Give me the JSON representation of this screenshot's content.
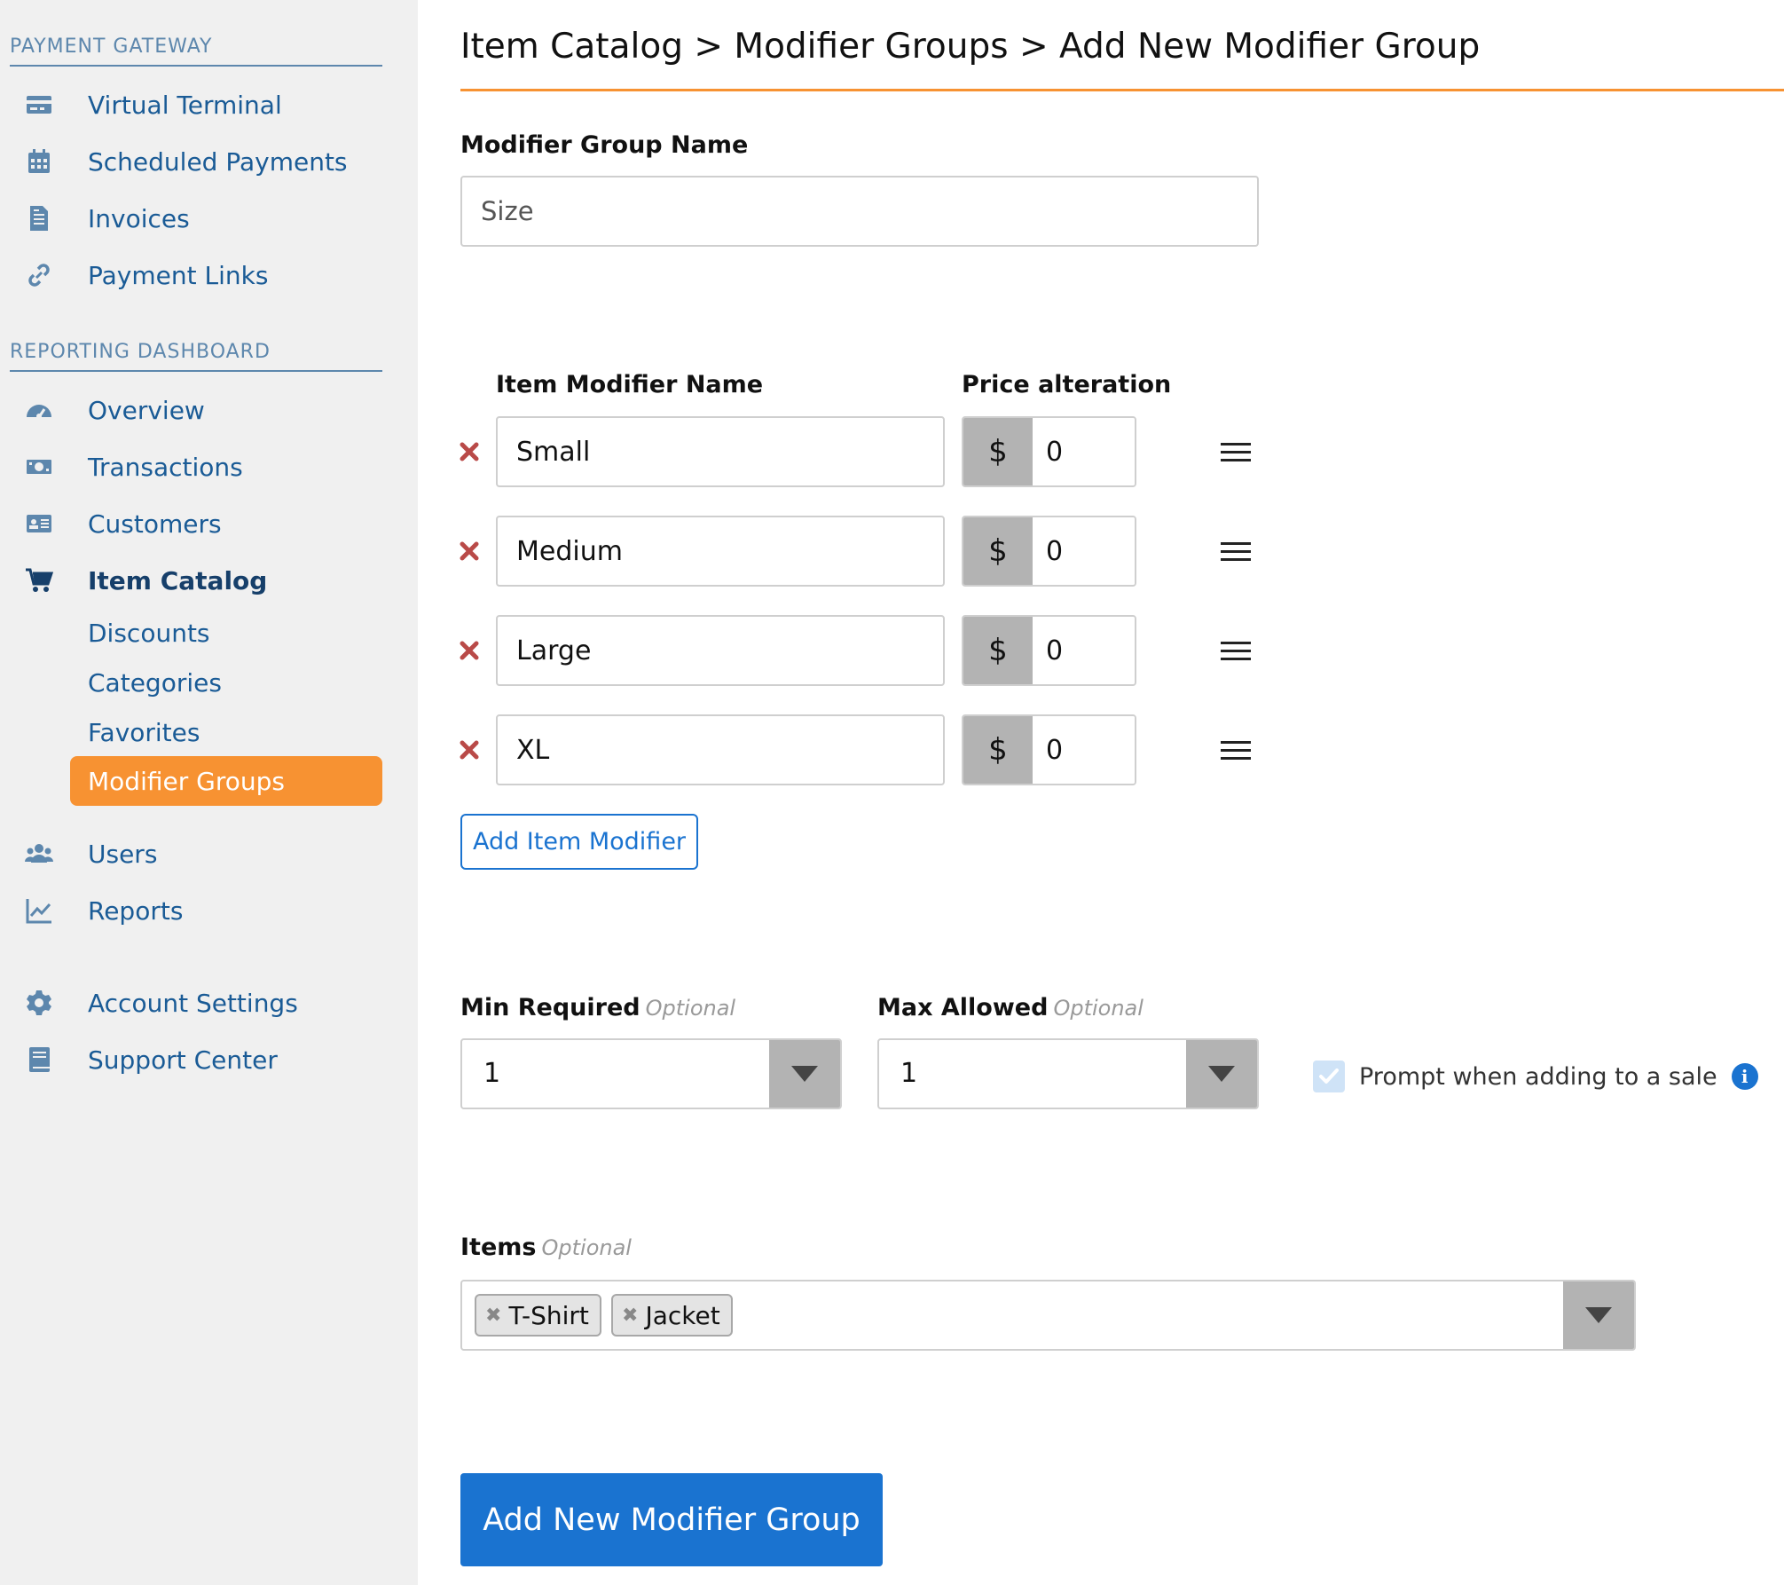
{
  "sidebar": {
    "payment_gateway_heading": "PAYMENT GATEWAY",
    "payment_items": [
      {
        "label": "Virtual Terminal",
        "icon": "credit-card-icon"
      },
      {
        "label": "Scheduled Payments",
        "icon": "calendar-icon"
      },
      {
        "label": "Invoices",
        "icon": "invoice-icon"
      },
      {
        "label": "Payment Links",
        "icon": "link-icon"
      }
    ],
    "reporting_heading": "REPORTING DASHBOARD",
    "reporting_items": [
      {
        "label": "Overview",
        "icon": "gauge-icon"
      },
      {
        "label": "Transactions",
        "icon": "money-icon"
      },
      {
        "label": "Customers",
        "icon": "id-card-icon"
      },
      {
        "label": "Item Catalog",
        "icon": "cart-icon"
      }
    ],
    "catalog_sub_items": [
      "Discounts",
      "Categories",
      "Favorites"
    ],
    "active_sub_item": "Modifier Groups",
    "lower_items": [
      {
        "label": "Users",
        "icon": "users-icon"
      },
      {
        "label": "Reports",
        "icon": "chart-icon"
      }
    ],
    "bottom_items": [
      {
        "label": "Account Settings",
        "icon": "gear-icon"
      },
      {
        "label": "Support Center",
        "icon": "book-icon"
      }
    ]
  },
  "page": {
    "breadcrumb": "Item Catalog > Modifier Groups > Add New Modifier Group",
    "group_name_label": "Modifier Group Name",
    "group_name_value": "Size",
    "modifier_name_header": "Item Modifier Name",
    "price_header": "Price alteration",
    "currency_symbol": "$",
    "modifiers": [
      {
        "name": "Small",
        "price": "0"
      },
      {
        "name": "Medium",
        "price": "0"
      },
      {
        "name": "Large",
        "price": "0"
      },
      {
        "name": "XL",
        "price": "0"
      }
    ],
    "add_modifier_button": "Add Item Modifier",
    "min_required_label": "Min Required",
    "max_allowed_label": "Max Allowed",
    "optional_text": "Optional",
    "min_required_value": "1",
    "max_allowed_value": "1",
    "prompt_label": "Prompt when adding to a sale",
    "prompt_checked": true,
    "items_label": "Items",
    "items_tags": [
      "T-Shirt",
      "Jacket"
    ],
    "submit_button": "Add New Modifier Group"
  },
  "colors": {
    "accent_orange": "#f79232",
    "primary_blue": "#1a73d0",
    "nav_blue": "#1a5b96",
    "delete_red": "#b94a48"
  }
}
